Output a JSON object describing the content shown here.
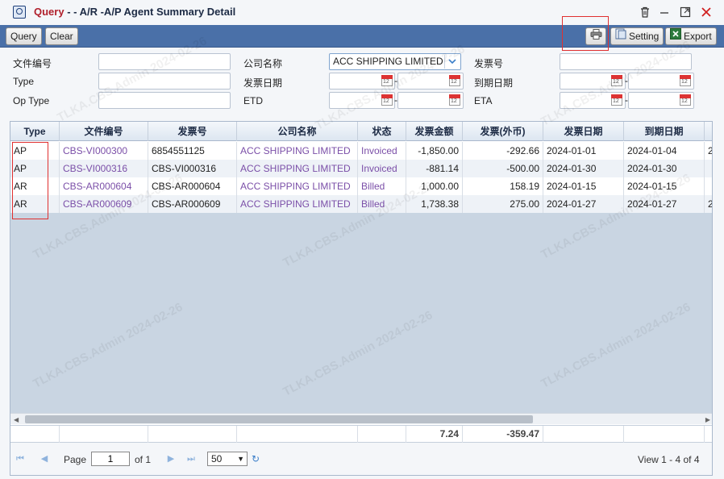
{
  "window": {
    "title_prefix": "Query",
    "title_rest": "- - A/R -A/P Agent Summary Detail"
  },
  "toolbar": {
    "query_label": "Query",
    "clear_label": "Clear",
    "setting_label": "Setting",
    "export_label": "Export"
  },
  "form": {
    "doc_no_label": "文件编号",
    "type_label": "Type",
    "op_type_label": "Op Type",
    "company_label": "公司名称",
    "company_value": "ACC SHIPPING LIMITED",
    "invoice_date_label": "发票日期",
    "etd_label": "ETD",
    "invoice_no_label": "发票号",
    "due_date_label": "到期日期",
    "eta_label": "ETA",
    "cal_day": "12"
  },
  "grid": {
    "columns": [
      "Type",
      "文件编号",
      "发票号",
      "公司名称",
      "状态",
      "发票金额",
      "发票(外币)",
      "发票日期",
      "到期日期"
    ],
    "rows": [
      {
        "type": "AP",
        "doc": "CBS-VI000300",
        "invoice": "6854551125",
        "company": "ACC SHIPPING LIMITED",
        "status": "Invoiced",
        "amount": "-1,850.00",
        "fx": "-292.66",
        "inv_date": "2024-01-01",
        "due_date": "2024-01-04",
        "extra": "2"
      },
      {
        "type": "AP",
        "doc": "CBS-VI000316",
        "invoice": "CBS-VI000316",
        "company": "ACC SHIPPING LIMITED",
        "status": "Invoiced",
        "amount": "-881.14",
        "fx": "-500.00",
        "inv_date": "2024-01-30",
        "due_date": "2024-01-30",
        "extra": ""
      },
      {
        "type": "AR",
        "doc": "CBS-AR000604",
        "invoice": "CBS-AR000604",
        "company": "ACC SHIPPING LIMITED",
        "status": "Billed",
        "amount": "1,000.00",
        "fx": "158.19",
        "inv_date": "2024-01-15",
        "due_date": "2024-01-15",
        "extra": ""
      },
      {
        "type": "AR",
        "doc": "CBS-AR000609",
        "invoice": "CBS-AR000609",
        "company": "ACC SHIPPING LIMITED",
        "status": "Billed",
        "amount": "1,738.38",
        "fx": "275.00",
        "inv_date": "2024-01-27",
        "due_date": "2024-01-27",
        "extra": "2"
      }
    ],
    "total_amount": "7.24",
    "total_fx": "-359.47"
  },
  "pager": {
    "page_label": "Page",
    "page_value": "1",
    "of_label": "of 1",
    "page_size": "50",
    "view_text": "View 1 - 4 of 4"
  },
  "watermark": "TLKA.CBS.Admin 2024-02-26",
  "colors": {
    "toolbar": "#4a70a8",
    "link": "#7b4fa8",
    "highlight_box": "#e03030"
  }
}
